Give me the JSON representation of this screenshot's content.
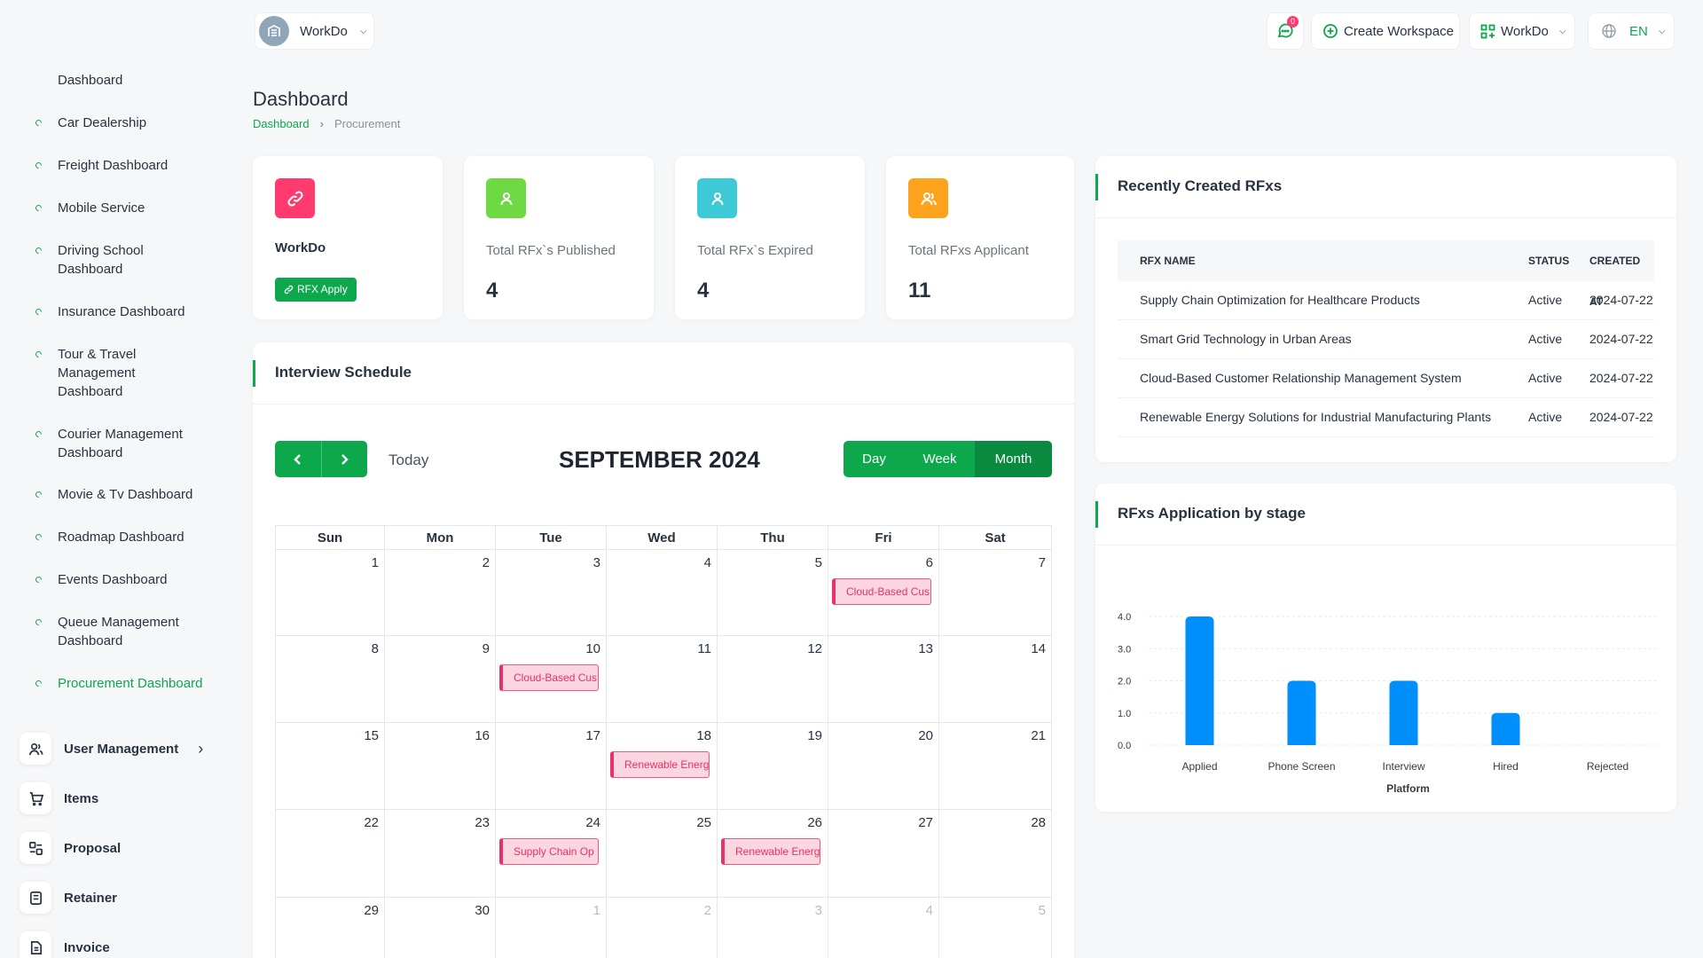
{
  "sidebar": {
    "sub_items": [
      {
        "label": "Dashboard",
        "active": false
      },
      {
        "label": "Car Dealership",
        "active": false
      },
      {
        "label": "Freight Dashboard",
        "active": false
      },
      {
        "label": "Mobile Service",
        "active": false
      },
      {
        "label": "Driving School Dashboard",
        "active": false
      },
      {
        "label": "Insurance Dashboard",
        "active": false
      },
      {
        "label": "Tour & Travel Management Dashboard",
        "active": false
      },
      {
        "label": "Courier Management Dashboard",
        "active": false
      },
      {
        "label": "Movie & Tv Dashboard",
        "active": false
      },
      {
        "label": "Roadmap Dashboard",
        "active": false
      },
      {
        "label": "Events Dashboard",
        "active": false
      },
      {
        "label": "Queue Management Dashboard",
        "active": false
      },
      {
        "label": "Procurement Dashboard",
        "active": true
      }
    ],
    "main_items": [
      {
        "label": "User Management",
        "icon": "users-icon"
      },
      {
        "label": "Items",
        "icon": "cart-icon"
      },
      {
        "label": "Proposal",
        "icon": "proposal-icon"
      },
      {
        "label": "Retainer",
        "icon": "retainer-icon"
      },
      {
        "label": "Invoice",
        "icon": "invoice-icon"
      }
    ]
  },
  "header": {
    "workspace_name": "WorkDo",
    "notification_count": "0",
    "create_workspace": "Create Workspace",
    "user_menu": "WorkDo",
    "language": "EN"
  },
  "page": {
    "title": "Dashboard",
    "breadcrumb": [
      "Dashboard",
      "Procurement"
    ]
  },
  "stats": [
    {
      "label": "WorkDo",
      "button": "RFX Apply",
      "color": "#ff3a6e",
      "icon": "link-icon"
    },
    {
      "label": "Total RFx`s Published",
      "value": "4",
      "color": "#6fd943",
      "icon": "user-icon"
    },
    {
      "label": "Total RFx`s Expired",
      "value": "4",
      "color": "#3ec9d6",
      "icon": "user-icon"
    },
    {
      "label": "Total RFxs Applicant",
      "value": "11",
      "color": "#ffa21d",
      "icon": "users-icon"
    }
  ],
  "calendar": {
    "title": "Interview Schedule",
    "month_label": "SEPTEMBER 2024",
    "today_label": "Today",
    "views": [
      "Day",
      "Week",
      "Month"
    ],
    "active_view": "Month",
    "weekdays": [
      "Sun",
      "Mon",
      "Tue",
      "Wed",
      "Thu",
      "Fri",
      "Sat"
    ],
    "weeks": [
      [
        {
          "d": "1"
        },
        {
          "d": "2"
        },
        {
          "d": "3"
        },
        {
          "d": "4"
        },
        {
          "d": "5"
        },
        {
          "d": "6",
          "event": "Cloud-Based Cus"
        },
        {
          "d": "7"
        }
      ],
      [
        {
          "d": "8"
        },
        {
          "d": "9"
        },
        {
          "d": "10",
          "event": "Cloud-Based Cus"
        },
        {
          "d": "11"
        },
        {
          "d": "12"
        },
        {
          "d": "13"
        },
        {
          "d": "14"
        }
      ],
      [
        {
          "d": "15"
        },
        {
          "d": "16"
        },
        {
          "d": "17"
        },
        {
          "d": "18",
          "event": "Renewable Energ"
        },
        {
          "d": "19"
        },
        {
          "d": "20"
        },
        {
          "d": "21"
        }
      ],
      [
        {
          "d": "22"
        },
        {
          "d": "23"
        },
        {
          "d": "24",
          "event": "Supply Chain Op"
        },
        {
          "d": "25"
        },
        {
          "d": "26",
          "event": "Renewable Energ"
        },
        {
          "d": "27"
        },
        {
          "d": "28"
        }
      ],
      [
        {
          "d": "29"
        },
        {
          "d": "30"
        },
        {
          "d": "1",
          "other": true
        },
        {
          "d": "2",
          "other": true
        },
        {
          "d": "3",
          "other": true
        },
        {
          "d": "4",
          "other": true
        },
        {
          "d": "5",
          "other": true
        }
      ]
    ]
  },
  "rfx_table": {
    "title": "Recently Created RFxs",
    "headers": [
      "RFX NAME",
      "STATUS",
      "CREATED AT"
    ],
    "rows": [
      [
        "Supply Chain Optimization for Healthcare Products",
        "Active",
        "2024-07-22"
      ],
      [
        "Smart Grid Technology in Urban Areas",
        "Active",
        "2024-07-22"
      ],
      [
        "Cloud-Based Customer Relationship Management System",
        "Active",
        "2024-07-22"
      ],
      [
        "Renewable Energy Solutions for Industrial Manufacturing Plants",
        "Active",
        "2024-07-22"
      ]
    ]
  },
  "chart_panel": {
    "title": "RFxs Application by stage"
  },
  "chart_data": {
    "type": "bar",
    "categories": [
      "Applied",
      "Phone Screen",
      "Interview",
      "Hired",
      "Rejected"
    ],
    "values": [
      4,
      2,
      2,
      1,
      0
    ],
    "xlabel": "Platform",
    "ylabel": "",
    "ylim": [
      0,
      4
    ],
    "yticks": [
      "0.0",
      "1.0",
      "2.0",
      "3.0",
      "4.0"
    ],
    "grid": true,
    "bar_color": "#008ffb"
  }
}
